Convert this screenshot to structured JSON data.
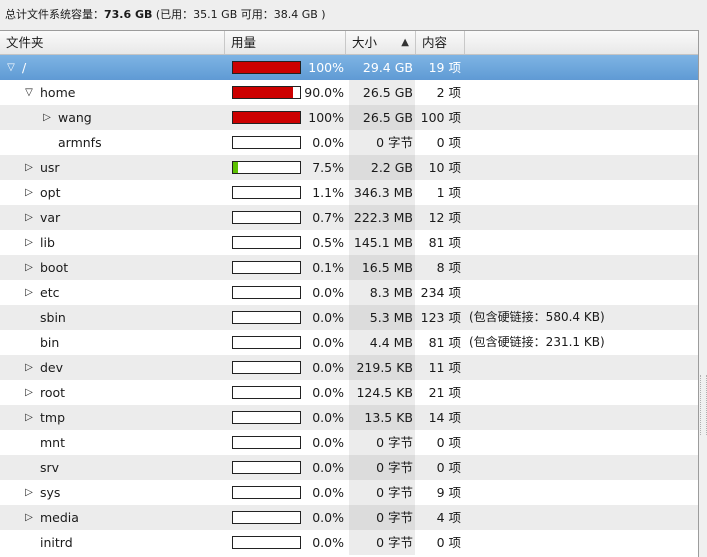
{
  "summary": {
    "prefix": "总计文件系统容量：",
    "total": "73.6 GB",
    "detail": "(已用：35.1 GB 可用：38.4 GB )"
  },
  "columns": {
    "folder": "文件夹",
    "usage": "用量",
    "size": "大小",
    "contents": "内容"
  },
  "colors": {
    "bar_full": "#cc0000",
    "bar_low": "#5cc000",
    "selection": "#6fa6dc"
  },
  "rows": [
    {
      "name": "/",
      "depth": 0,
      "expander": "down",
      "usage": 1.0,
      "bar_color": "#cc0000",
      "pct": "100%",
      "size": "29.4 GB",
      "items": "19 项",
      "note": "",
      "selected": true
    },
    {
      "name": "home",
      "depth": 1,
      "expander": "down",
      "usage": 0.9,
      "bar_color": "#cc0000",
      "pct": "90.0%",
      "size": "26.5 GB",
      "items": "2 项",
      "note": ""
    },
    {
      "name": "wang",
      "depth": 2,
      "expander": "right",
      "usage": 1.0,
      "bar_color": "#cc0000",
      "pct": "100%",
      "size": "26.5 GB",
      "items": "100 项",
      "note": ""
    },
    {
      "name": "armnfs",
      "depth": 2,
      "expander": "none",
      "usage": 0.0,
      "bar_color": "#cc0000",
      "pct": "0.0%",
      "size": "0 字节",
      "items": "0 项",
      "note": ""
    },
    {
      "name": "usr",
      "depth": 1,
      "expander": "right",
      "usage": 0.075,
      "bar_color": "#5cc000",
      "pct": "7.5%",
      "size": "2.2 GB",
      "items": "10 项",
      "note": ""
    },
    {
      "name": "opt",
      "depth": 1,
      "expander": "right",
      "usage": 0.0,
      "bar_color": "#5cc000",
      "pct": "1.1%",
      "size": "346.3 MB",
      "items": "1 项",
      "note": ""
    },
    {
      "name": "var",
      "depth": 1,
      "expander": "right",
      "usage": 0.0,
      "bar_color": "#5cc000",
      "pct": "0.7%",
      "size": "222.3 MB",
      "items": "12 项",
      "note": ""
    },
    {
      "name": "lib",
      "depth": 1,
      "expander": "right",
      "usage": 0.0,
      "bar_color": "#5cc000",
      "pct": "0.5%",
      "size": "145.1 MB",
      "items": "81 项",
      "note": ""
    },
    {
      "name": "boot",
      "depth": 1,
      "expander": "right",
      "usage": 0.0,
      "bar_color": "#5cc000",
      "pct": "0.1%",
      "size": "16.5 MB",
      "items": "8 项",
      "note": ""
    },
    {
      "name": "etc",
      "depth": 1,
      "expander": "right",
      "usage": 0.0,
      "bar_color": "#5cc000",
      "pct": "0.0%",
      "size": "8.3 MB",
      "items": "234 项",
      "note": ""
    },
    {
      "name": "sbin",
      "depth": 1,
      "expander": "none",
      "usage": 0.0,
      "bar_color": "#5cc000",
      "pct": "0.0%",
      "size": "5.3 MB",
      "items": "123 项",
      "note": "(包含硬链接：580.4 KB)"
    },
    {
      "name": "bin",
      "depth": 1,
      "expander": "none",
      "usage": 0.0,
      "bar_color": "#5cc000",
      "pct": "0.0%",
      "size": "4.4 MB",
      "items": "81 项",
      "note": "(包含硬链接：231.1 KB)"
    },
    {
      "name": "dev",
      "depth": 1,
      "expander": "right",
      "usage": 0.0,
      "bar_color": "#5cc000",
      "pct": "0.0%",
      "size": "219.5 KB",
      "items": "11 项",
      "note": ""
    },
    {
      "name": "root",
      "depth": 1,
      "expander": "right",
      "usage": 0.0,
      "bar_color": "#5cc000",
      "pct": "0.0%",
      "size": "124.5 KB",
      "items": "21 项",
      "note": ""
    },
    {
      "name": "tmp",
      "depth": 1,
      "expander": "right",
      "usage": 0.0,
      "bar_color": "#5cc000",
      "pct": "0.0%",
      "size": "13.5 KB",
      "items": "14 项",
      "note": ""
    },
    {
      "name": "mnt",
      "depth": 1,
      "expander": "none",
      "usage": 0.0,
      "bar_color": "#5cc000",
      "pct": "0.0%",
      "size": "0 字节",
      "items": "0 项",
      "note": ""
    },
    {
      "name": "srv",
      "depth": 1,
      "expander": "none",
      "usage": 0.0,
      "bar_color": "#5cc000",
      "pct": "0.0%",
      "size": "0 字节",
      "items": "0 项",
      "note": ""
    },
    {
      "name": "sys",
      "depth": 1,
      "expander": "right",
      "usage": 0.0,
      "bar_color": "#5cc000",
      "pct": "0.0%",
      "size": "0 字节",
      "items": "9 项",
      "note": ""
    },
    {
      "name": "media",
      "depth": 1,
      "expander": "right",
      "usage": 0.0,
      "bar_color": "#5cc000",
      "pct": "0.0%",
      "size": "0 字节",
      "items": "4 项",
      "note": ""
    },
    {
      "name": "initrd",
      "depth": 1,
      "expander": "none",
      "usage": 0.0,
      "bar_color": "#5cc000",
      "pct": "0.0%",
      "size": "0 字节",
      "items": "0 项",
      "note": ""
    }
  ]
}
